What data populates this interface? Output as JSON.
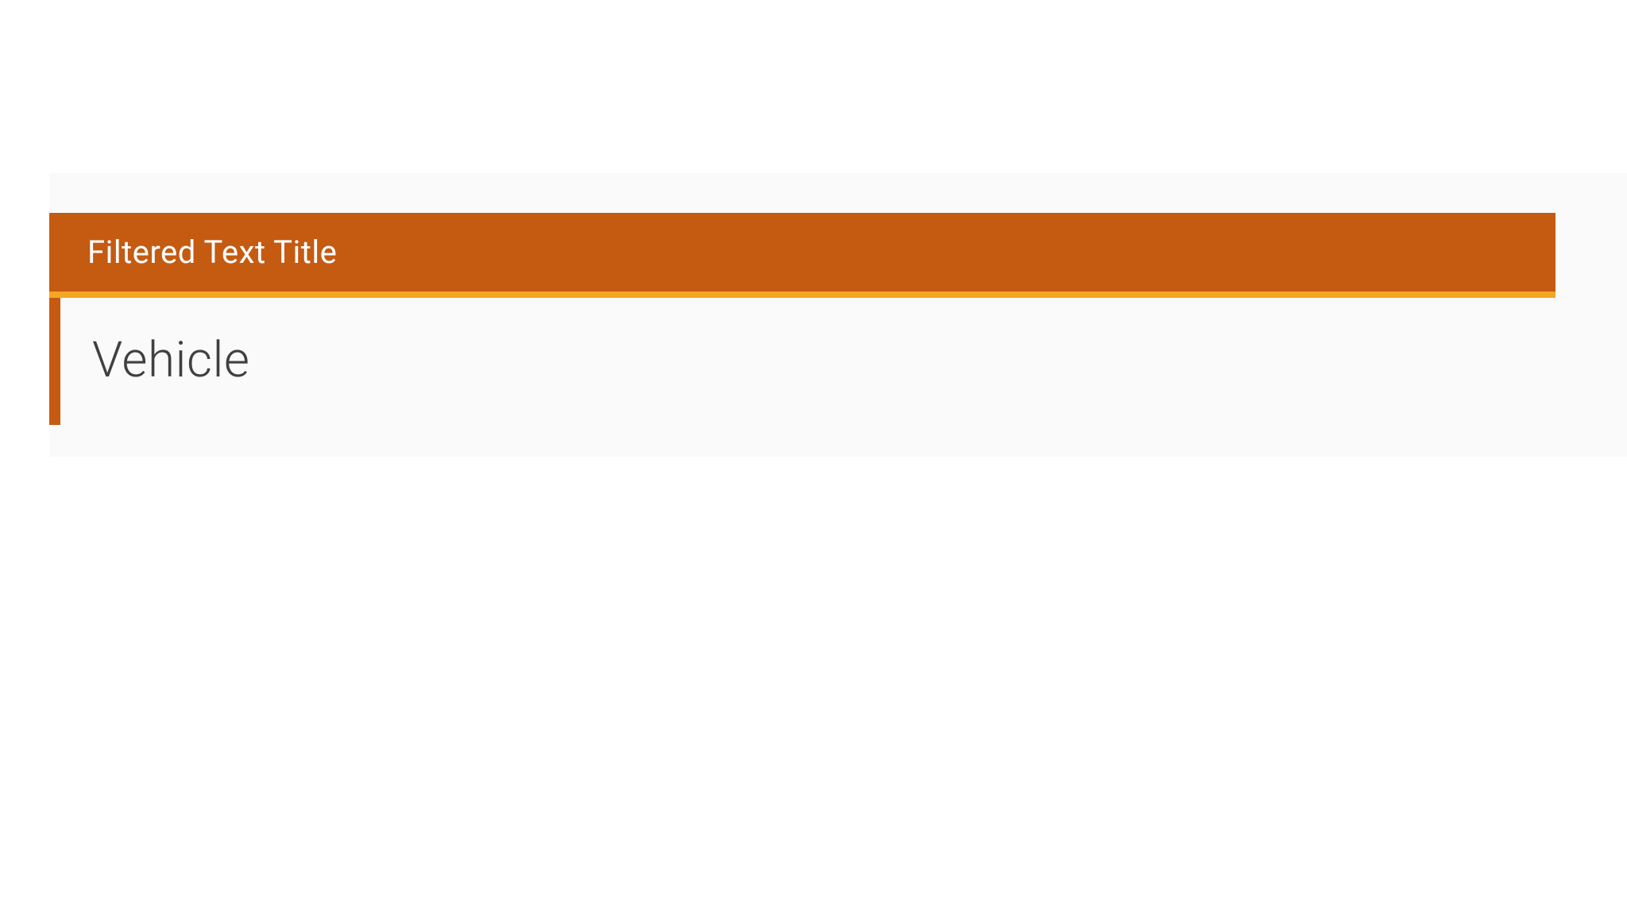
{
  "panel": {
    "title": "Filtered Text Title",
    "value": "Vehicle"
  },
  "colors": {
    "header_bg": "#c55a11",
    "accent": "#f5a623",
    "panel_bg": "#fafafa",
    "text": "#404040"
  }
}
